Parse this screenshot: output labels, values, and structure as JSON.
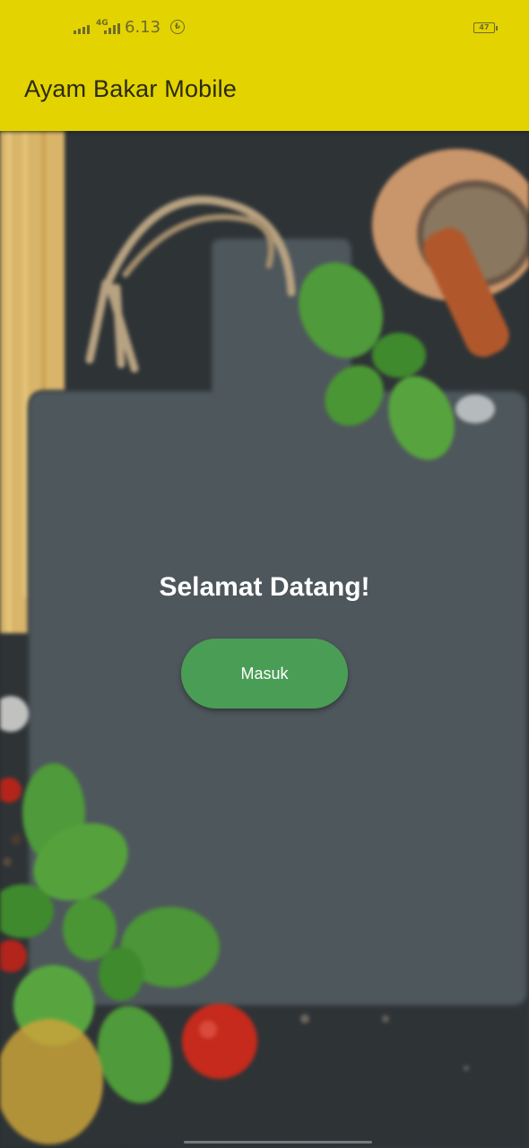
{
  "status_bar": {
    "network": "4G",
    "time": "6.13",
    "notification_icon": "shield-icon",
    "battery": "47"
  },
  "appbar": {
    "title": "Ayam Bakar Mobile",
    "color": "#e3d300"
  },
  "main": {
    "greeting": "Selamat Datang!",
    "login_button": "Masuk",
    "button_color": "#4a9d55",
    "background_image": "cutting-board-with-herbs-photo"
  }
}
